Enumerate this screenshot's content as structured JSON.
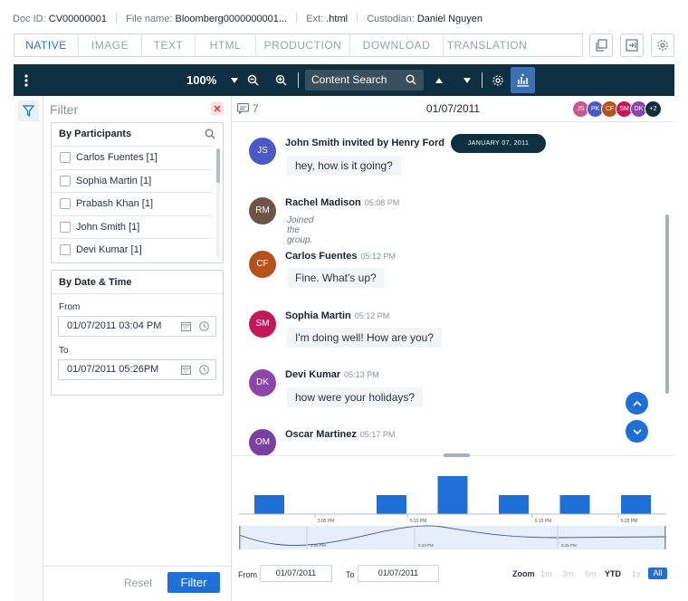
{
  "doc": {
    "id_label": "Doc ID:",
    "id_value": "CV00000001",
    "file_label": "File name:",
    "file_value": "Bloomberg0000000001...",
    "ext_label": "Ext:",
    "ext_value": ".html",
    "custodian_label": "Custodian:",
    "custodian_value": "Daniel Nguyen"
  },
  "tabs": [
    "NATIVE",
    "IMAGE",
    "TEXT",
    "HTML",
    "PRODUCTION",
    "DOWNLOAD",
    "TRANSLATION"
  ],
  "active_tab": "NATIVE",
  "toolbar": {
    "zoom": "100%",
    "search_placeholder": "Content Search"
  },
  "filter": {
    "title": "Filter",
    "participants_title": "By Participants",
    "participants": [
      "Carlos Fuentes [1]",
      "Sophia Martin [1]",
      "Prabash Khan [1]",
      "John Smith [1]",
      "Devi Kumar [1]"
    ],
    "date_title": "By Date & Time",
    "from_label": "From",
    "from_value": "01/07/2011 03:04 PM",
    "to_label": "To",
    "to_value": "01/07/2011 05:26PM",
    "reset_label": "Reset",
    "filter_label": "Filter"
  },
  "chat": {
    "count": "7",
    "date": "01/07/2011",
    "avatar_stack": [
      {
        "initials": "JS",
        "color": "#c35a8e"
      },
      {
        "initials": "PK",
        "color": "#4b59c4"
      },
      {
        "initials": "CF",
        "color": "#b3531b"
      },
      {
        "initials": "SM",
        "color": "#c2185b"
      },
      {
        "initials": "DK",
        "color": "#8e44ad"
      },
      {
        "initials": "+2",
        "color": "#0d2f3f"
      }
    ],
    "date_pill": "JANUARY 07, 2011",
    "messages": [
      {
        "initials": "JS",
        "color": "#4b59c4",
        "name": "John Smith invited by Henry Ford",
        "time": "",
        "text": "hey, how is it going?"
      },
      {
        "initials": "RM",
        "color": "#6d5447",
        "name": "Rachel Madison",
        "time": "05:08 PM",
        "text": "Joined the group."
      },
      {
        "initials": "CF",
        "color": "#b3531b",
        "name": "Carlos Fuentes",
        "time": "05:12 PM",
        "text": "Fine. What's up?"
      },
      {
        "initials": "SM",
        "color": "#c2185b",
        "name": "Sophia Martin",
        "time": "05:12 PM",
        "text": "I'm doing well! How are you?"
      },
      {
        "initials": "DK",
        "color": "#8e44ad",
        "name": "Devi Kumar",
        "time": "05:13 PM",
        "text": "how were your holidays?"
      },
      {
        "initials": "OM",
        "color": "#7b3fa0",
        "name": "Oscar Martinez",
        "time": "05:17 PM",
        "text": ""
      }
    ]
  },
  "chart_data": {
    "type": "bar",
    "values": [
      1,
      0,
      1,
      2,
      1,
      1,
      1
    ],
    "ylim": [
      0,
      2
    ],
    "x_ticks": [
      "3:05 PM",
      "5:10 PM",
      "5:15 PM",
      "5:25 PM"
    ],
    "navigator_ticks": [
      "3:05 PM",
      "5:10 PM",
      "5:15 PM"
    ],
    "color": "#1f6fd6"
  },
  "range": {
    "from_label": "From",
    "from_value": "01/07/2011",
    "to_label": "To",
    "to_value": "01/07/2011",
    "zoom_label": "Zoom",
    "buttons": [
      "1m",
      "3m",
      "6m",
      "YTD",
      "1y",
      "All"
    ]
  }
}
